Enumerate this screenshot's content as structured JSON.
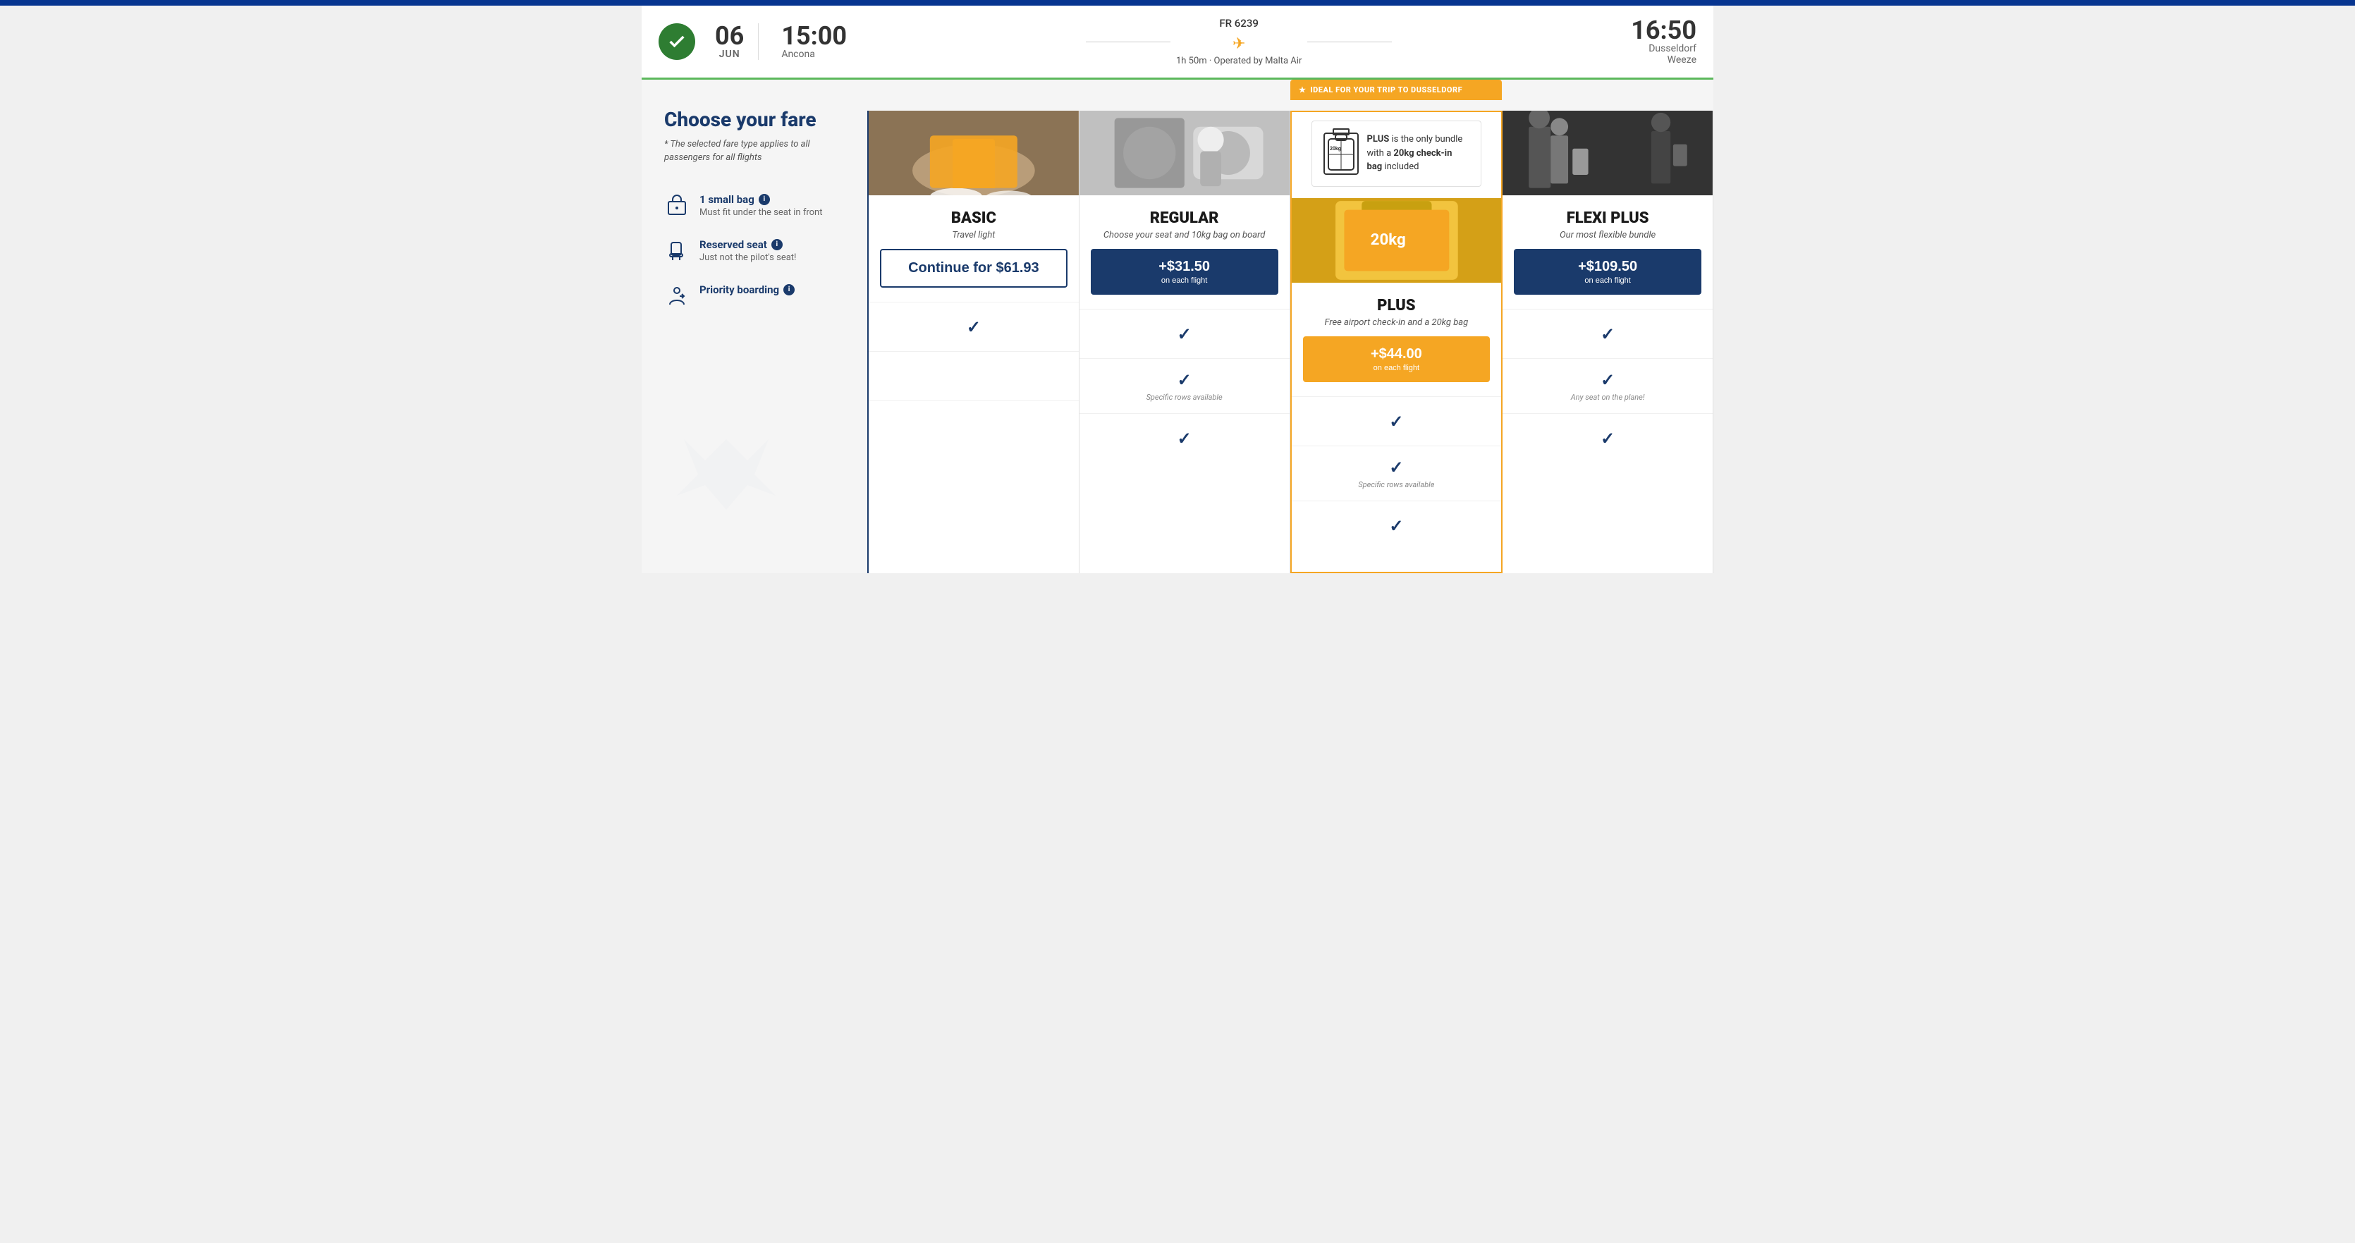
{
  "topNav": {
    "color": "#073590"
  },
  "flightHeader": {
    "date": {
      "day": "06",
      "month": "JUN"
    },
    "departure": {
      "time": "15:00",
      "city": "Ancona"
    },
    "flightNumber": "FR 6239",
    "duration": "1h 50m · Operated by Malta Air",
    "arrival": {
      "time": "16:50",
      "city1": "Dusseldorf",
      "city2": "Weeze"
    }
  },
  "sidebar": {
    "title": "Choose your fare",
    "subtitle": "* The selected fare type applies to all passengers for all flights",
    "features": [
      {
        "id": "small-bag",
        "icon": "bag",
        "title": "1 small bag",
        "info": true,
        "desc": "Must fit under the seat in front"
      },
      {
        "id": "reserved-seat",
        "icon": "seat",
        "title": "Reserved seat",
        "info": true,
        "desc": "Just not the pilot's seat!"
      },
      {
        "id": "priority-boarding",
        "icon": "boarding",
        "title": "Priority boarding",
        "info": true,
        "desc": ""
      }
    ]
  },
  "plusBanner": {
    "text": "IDEAL FOR YOUR TRIP TO DUSSELDORF"
  },
  "plusInfoBox": {
    "luggageLabel": "20kg",
    "text1": "PLUS",
    "text2": " is the only bundle with a ",
    "text3": "20kg check-in bag",
    "text4": " included"
  },
  "fares": [
    {
      "id": "basic",
      "name": "BASIC",
      "tagline": "Travel light",
      "btnType": "outline",
      "priceMain": "Continue for $61.93",
      "priceSub": "",
      "imageClass": "img-basic",
      "checks": [
        true,
        false,
        false
      ],
      "notes": [
        "",
        "",
        ""
      ]
    },
    {
      "id": "regular",
      "name": "REGULAR",
      "tagline": "Choose your seat and 10kg bag on board",
      "btnType": "blue",
      "priceMain": "+$31.50",
      "priceSub": "on each flight",
      "imageClass": "img-regular",
      "checks": [
        true,
        true,
        false
      ],
      "notes": [
        "",
        "Specific rows available",
        ""
      ]
    },
    {
      "id": "plus",
      "name": "PLUS",
      "tagline": "Free airport check-in and a 20kg bag",
      "btnType": "gold",
      "priceMain": "+$44.00",
      "priceSub": "on each flight",
      "imageClass": "img-plus",
      "checks": [
        true,
        true,
        false
      ],
      "notes": [
        "",
        "Specific rows available",
        ""
      ]
    },
    {
      "id": "flexi-plus",
      "name": "FLEXI PLUS",
      "tagline": "Our most flexible bundle",
      "btnType": "blue",
      "priceMain": "+$109.50",
      "priceSub": "on each flight",
      "imageClass": "img-flexi",
      "checks": [
        true,
        true,
        false
      ],
      "notes": [
        "",
        "Any seat on the plane!",
        ""
      ]
    }
  ]
}
